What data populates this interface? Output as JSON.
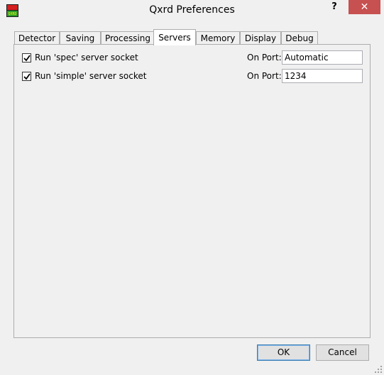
{
  "window": {
    "title": "Qxrd Preferences",
    "help_label": "?",
    "close_label": "✕",
    "icon": "qxrd-app-icon"
  },
  "tabs": [
    {
      "label": "Detector",
      "active": false
    },
    {
      "label": "Saving",
      "active": false
    },
    {
      "label": "Processing",
      "active": false
    },
    {
      "label": "Servers",
      "active": true
    },
    {
      "label": "Memory",
      "active": false
    },
    {
      "label": "Display",
      "active": false
    },
    {
      "label": "Debug",
      "active": false
    }
  ],
  "servers": {
    "spec": {
      "checked": true,
      "label": "Run 'spec' server socket",
      "port_label": "On Port:",
      "port_value": "Automatic"
    },
    "simple": {
      "checked": true,
      "label": "Run 'simple' server socket",
      "port_label": "On Port:",
      "port_value": "1234"
    }
  },
  "buttons": {
    "ok": "OK",
    "cancel": "Cancel"
  },
  "colors": {
    "close": "#c75050",
    "background": "#f0f0f0"
  }
}
